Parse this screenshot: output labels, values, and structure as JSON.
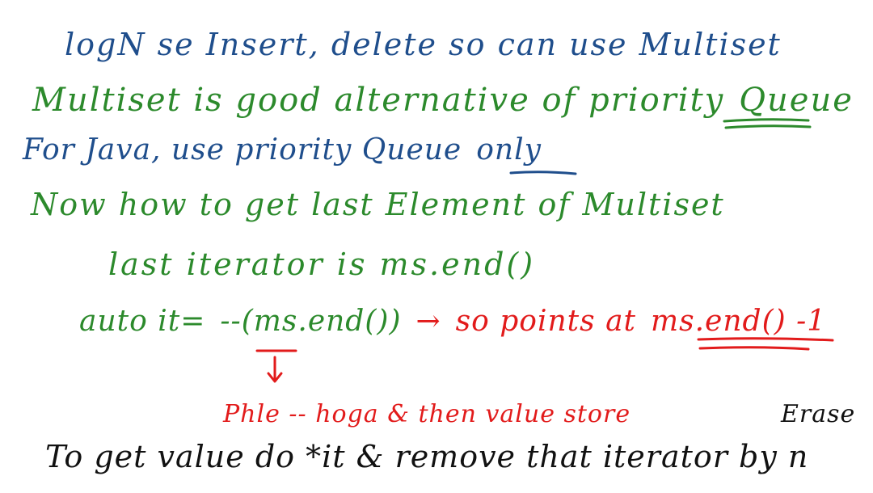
{
  "notes": {
    "line1": "logN se Insert, delete so can use Multiset",
    "line2_text": "Multiset is good alternative of priority",
    "line2_emphasis": "Queue",
    "line3_text": "For Java, use priority Queue",
    "line3_emphasis": "only",
    "line4": "Now how to get last Element of Multiset",
    "line5": "last iterator is ms.end()",
    "line6_prefix": "auto it=",
    "line6_decrement": "--",
    "line6_call": "(ms.end())",
    "line6_arrow": "→",
    "line6_note": "so points at",
    "line6_emphasis": "ms.end() -1",
    "line7": "Phle -- hoga & then value store",
    "line8": "Erase",
    "line9": "To get value do *it & remove that iterator by n"
  },
  "colors": {
    "blue": "#1f4e8c",
    "green": "#2c8a2c",
    "red": "#e21b1b",
    "black": "#111111",
    "background": "#ffffff"
  }
}
